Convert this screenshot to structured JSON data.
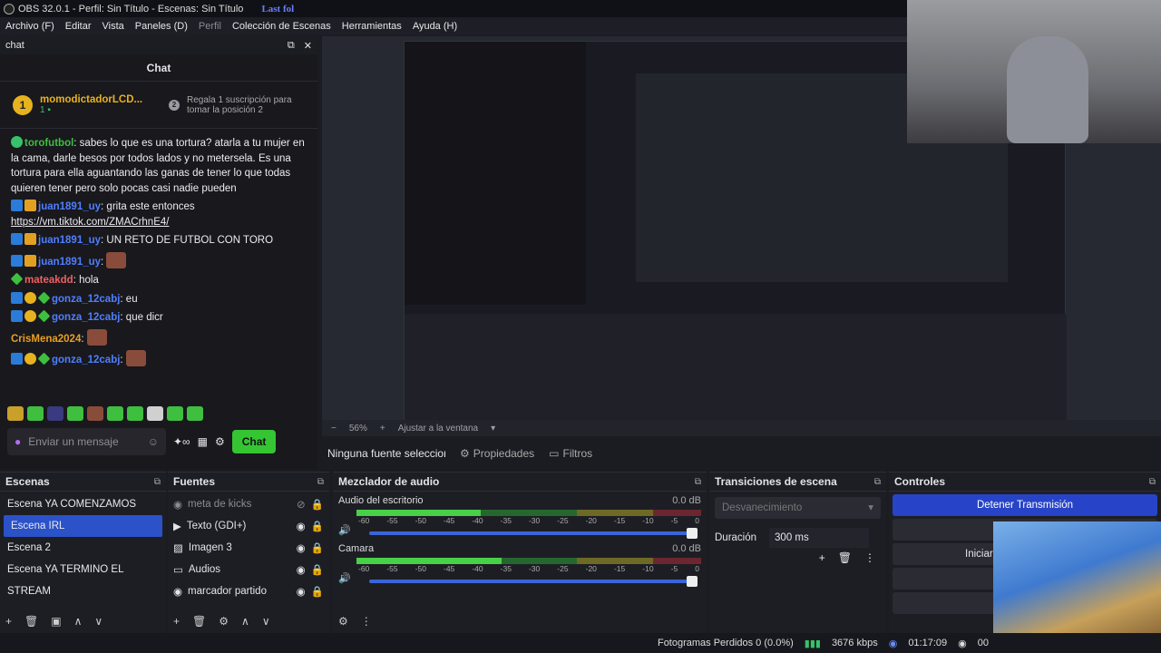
{
  "titlebar": {
    "title": "OBS 32.0.1 - Perfil: Sin Título - Escenas: Sin Título",
    "overlay": "Last fol"
  },
  "menu": [
    {
      "label": "Archivo (F)"
    },
    {
      "label": "Editar"
    },
    {
      "label": "Vista"
    },
    {
      "label": "Paneles (D)"
    },
    {
      "label": "Perfil"
    },
    {
      "label": "Colección de Escenas"
    },
    {
      "label": "Herramientas"
    },
    {
      "label": "Ayuda (H)"
    }
  ],
  "chatdock": {
    "dock_title": "chat",
    "title": "Chat",
    "leader": {
      "rank": "1",
      "name": "momodictadorLCD...",
      "count": "1"
    },
    "promo": {
      "rank": "2",
      "text": "Regala 1 suscripción para tomar la posición 2"
    },
    "messages": [
      {
        "user": "torofutbol",
        "color": "#3fbf3f",
        "text": ": sabes lo que es una tortura? atarla a tu mujer en la cama, darle besos por todos lados y no metersela. Es una tortura para ella aguantando las ganas de tener lo que todas quieren tener pero solo pocas casi nadie pueden"
      },
      {
        "user": "juan1891_uy",
        "color": "#4f7fff",
        "text": ": grita este entonces",
        "link": "https://vm.tiktok.com/ZMACrhnE4/"
      },
      {
        "user": "juan1891_uy",
        "color": "#4f7fff",
        "text": ": UN RETO DE FUTBOL CON TORO"
      },
      {
        "user": "juan1891_uy",
        "color": "#4f7fff",
        "text": ":"
      },
      {
        "user": "mateakdd",
        "color": "#f06060",
        "text": ": hola"
      },
      {
        "user": "gonza_12cabj",
        "color": "#4f7fff",
        "text": ": eu"
      },
      {
        "user": "gonza_12cabj",
        "color": "#4f7fff",
        "text": ": que dicr"
      },
      {
        "user": "CrisMena2024",
        "color": "#e8a020",
        "text": ":"
      },
      {
        "user": "gonza_12cabj",
        "color": "#4f7fff",
        "text": ":"
      }
    ],
    "input_placeholder": "Enviar un mensaje",
    "send_label": "Chat"
  },
  "preview": {
    "zoom": "56%",
    "fit_label": "Ajustar a la ventana"
  },
  "propsbar": {
    "no_source": "Ninguna fuente seleccionada",
    "properties": "Propiedades",
    "filters": "Filtros"
  },
  "scenes": {
    "title": "Escenas",
    "items": [
      "Escena YA COMENZAMOS",
      "Escena IRL",
      "Escena 2",
      "Escena YA TERMINO EL STREAM"
    ],
    "selected_index": 1
  },
  "sources": {
    "title": "Fuentes",
    "items": [
      {
        "label": "meta de kicks",
        "hidden": true
      },
      {
        "label": "Texto (GDI+)",
        "hidden": false
      },
      {
        "label": "Imagen 3",
        "hidden": false
      },
      {
        "label": "Audios",
        "hidden": false
      },
      {
        "label": "marcador partido",
        "hidden": false
      }
    ]
  },
  "mixer": {
    "title": "Mezclador de audio",
    "tracks": [
      {
        "name": "Audio del escritorio",
        "db": "0.0 dB",
        "level": 0.36
      },
      {
        "name": "Camara",
        "db": "0.0 dB",
        "level": 0.42
      }
    ],
    "scale": [
      "-60",
      "-55",
      "-50",
      "-45",
      "-40",
      "-35",
      "-30",
      "-25",
      "-20",
      "-15",
      "-10",
      "-5",
      "0"
    ]
  },
  "transitions": {
    "title": "Transiciones de escena",
    "selected": "Desvanecimiento",
    "duration_label": "Duración",
    "duration_value": "300 ms"
  },
  "controls": {
    "title": "Controles",
    "stop_stream": "Detener Transmisión",
    "start_label": "Iniciar"
  },
  "status": {
    "dropped": "Fotogramas Perdidos 0 (0.0%)",
    "bitrate": "3676 kbps",
    "time": "01:17:09",
    "rec": "00"
  },
  "colors": {
    "accent": "#2b52c9",
    "chat_button": "#35c533",
    "stop_button": "#2744c8"
  }
}
